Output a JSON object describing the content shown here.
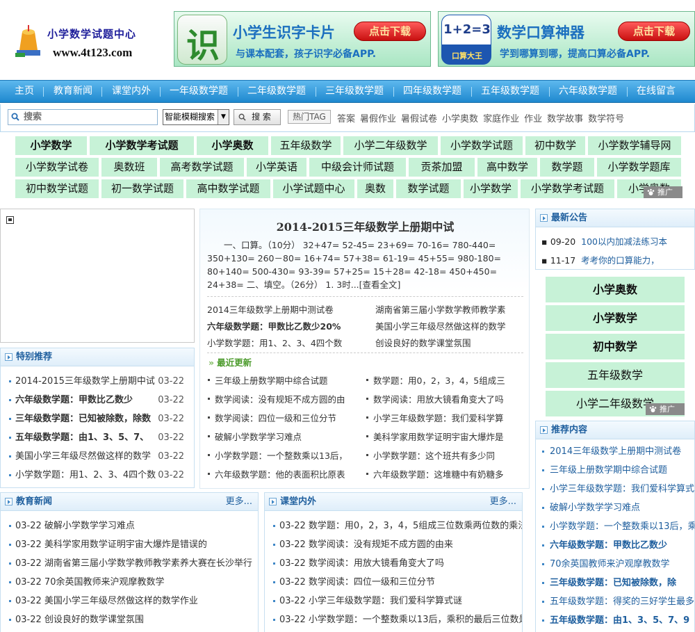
{
  "logo": {
    "title": "小学数学试题中心",
    "url": "www.4t123.com"
  },
  "banners": [
    {
      "icon_text": "识",
      "title": "小学生识字卡片",
      "subtitle": "与课本配套，孩子识字必备APP.",
      "button": "点击下载"
    },
    {
      "icon_text": "1+2=3",
      "icon_sub": "口算大王",
      "title": "数学口算神器",
      "subtitle": "学到哪算到哪，提高口算必备APP.",
      "button": "点击下载"
    }
  ],
  "nav": [
    "主页",
    "教育新闻",
    "课堂内外",
    "一年级数学题",
    "二年级数学题",
    "三年级数学题",
    "四年级数学题",
    "五年级数学题",
    "六年级数学题",
    "在线留言"
  ],
  "search": {
    "placeholder": "搜索",
    "mode": "智能模糊搜索",
    "button": "搜 索",
    "hot_tag_label": "热门TAG",
    "hot_tags": [
      "答案",
      "暑假作业",
      "暑假试卷",
      "小学奥数",
      "家庭作业",
      "作业",
      "数学故事",
      "数学符号"
    ]
  },
  "tags": [
    [
      "小学数学",
      "小学数学考试题",
      "小学奥数",
      "五年级数学",
      "小学二年级数学",
      "小学数学试题",
      "初中数学",
      "小学数学辅导网"
    ],
    [
      "小学数学试卷",
      "奥数班",
      "高考数学试题",
      "小学英语",
      "中级会计师试题",
      "贡茶加盟",
      "高中数学",
      "数学题",
      "小学数学题库"
    ],
    [
      "初中数学试题",
      "初一数学试题",
      "高中数学试题",
      "小学试题中心",
      "奥数",
      "数学试题",
      "小学数学",
      "小学数学考试题",
      "小学奥数"
    ]
  ],
  "promo_label": "推广",
  "featured": {
    "title": "特别推荐",
    "items": [
      {
        "text": "2014-2015三年级数学上册期中试",
        "date": "03-22"
      },
      {
        "text": "六年级数学题：甲数比乙数少",
        "date": "03-22"
      },
      {
        "text": "三年级数学题：已知被除数，除数",
        "date": "03-22"
      },
      {
        "text": "五年级数学题：由1、3、5、7、",
        "date": "03-22"
      },
      {
        "text": "美国小学三年级尽然做这样的数学",
        "date": "03-22"
      },
      {
        "text": "小学数学题：用1、2、3、4四个数",
        "date": "03-22"
      }
    ]
  },
  "headline": {
    "title": "2014-2015三年级数学上册期中试",
    "summary": "一、口算。（10分） 32+47= 52-45= 23+69= 70-16= 780-440= 350+130= 260－80= 16+74= 57+38= 61-19= 45+55= 980-180= 80+140= 500-430= 93-39= 57+25= 15＋28= 42-18= 450+450= 24+38= 二、填空。（26分） 1. 3时...",
    "read_more": "[查看全文]",
    "links": [
      "2014三年级数学上册期中测试卷",
      "湖南省第三届小学数学教师教学素",
      "六年级数学题：甲数比乙数少20%",
      "美国小学三年级尽然做这样的数学",
      "小学数学题：用1、2、3、4四个数",
      "创设良好的数学课堂氛围"
    ],
    "recent_title": "最近更新",
    "recent": [
      "三年级上册数学期中综合试题",
      "数学题：用0，2，3，4，5组成三",
      "数学阅读：没有规矩不成方圆的由",
      "数学阅读：用放大镜看角变大了吗",
      "数学阅读：四位一级和三位分节",
      "小学三年级数学题：我们爱科学算",
      "破解小学数学学习难点",
      "美科学家用数学证明宇宙大爆炸是",
      "小学数学题：一个整数乘以13后，",
      "小学数学题：这个班共有多少同",
      "六年级数学题：他的表面积比原表",
      "六年级数学题：这堆糖中有奶糖多"
    ]
  },
  "notice": {
    "title": "最新公告",
    "items": [
      {
        "date": "09-20",
        "text": "100以内加减法练习本"
      },
      {
        "date": "11-17",
        "text": "考考你的口算能力，"
      }
    ]
  },
  "side_tags": [
    "小学奥数",
    "小学数学",
    "初中数学",
    "五年级数学",
    "小学二年级数学"
  ],
  "recommend": {
    "title": "推荐内容",
    "items": [
      "2014三年级数学上册期中测试卷",
      "三年级上册数学期中综合试题",
      "小学三年级数学题：我们爱科学算式谜",
      "破解小学数学学习难点",
      "小学数学题：一个整数乘以13后，乘",
      "六年级数学题：甲数比乙数少",
      "70余英国教师来沪观摩教数学",
      "三年级数学题：已知被除数，除",
      "五年级数学题：得奖的三好学生最多有",
      "五年级数学题：由1、3、5、7、9"
    ]
  },
  "edu_news": {
    "title": "教育新闻",
    "more": "更多...",
    "items": [
      {
        "date": "03-22",
        "text": "破解小学数学学习难点"
      },
      {
        "date": "03-22",
        "text": "美科学家用数学证明宇宙大爆炸是错误的"
      },
      {
        "date": "03-22",
        "text": "湖南省第三届小学数学教师教学素养大赛在长沙举行"
      },
      {
        "date": "03-22",
        "text": "70余英国教师来沪观摩教数学"
      },
      {
        "date": "03-22",
        "text": "美国小学三年级尽然做这样的数学作业"
      },
      {
        "date": "03-22",
        "text": "创设良好的数学课堂氛围"
      }
    ]
  },
  "classroom": {
    "title": "课堂内外",
    "more": "更多...",
    "items": [
      {
        "date": "03-22",
        "text": "数学题：用0，2，3，4，5组成三位数乘两位数的乘法算"
      },
      {
        "date": "03-22",
        "text": "数学阅读：没有规矩不成方圆的由来"
      },
      {
        "date": "03-22",
        "text": "数学阅读：用放大镜看角变大了吗"
      },
      {
        "date": "03-22",
        "text": "数学阅读：四位一级和三位分节"
      },
      {
        "date": "03-22",
        "text": "小学三年级数学题：我们爱科学算式谜"
      },
      {
        "date": "03-22",
        "text": "小学数学题：一个整数乘以13后，乘积的最后三位数是"
      }
    ]
  },
  "colors": {
    "nav": "#1e88cf",
    "tag_bg": "#c7f2d7",
    "box_title": "#1f5f9e",
    "banner_title": "#1b6fbf"
  }
}
